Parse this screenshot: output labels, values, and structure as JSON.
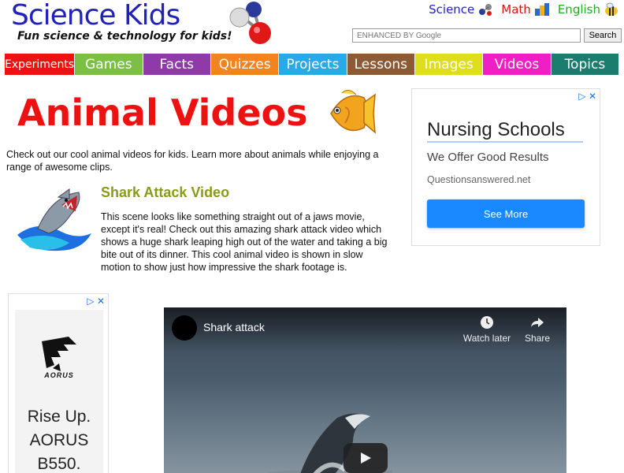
{
  "header": {
    "logo_title": "Science Kids",
    "logo_tagline": "Fun science & technology for kids!",
    "subjects": [
      {
        "label": "Science",
        "color": "#2222cc",
        "icon": "atom-icon"
      },
      {
        "label": "Math",
        "color": "#dd1111",
        "icon": "math-blocks-icon"
      },
      {
        "label": "English",
        "color": "#22aa22",
        "icon": "bee-icon"
      }
    ],
    "search_placeholder": "ENHANCED BY Google",
    "search_button": "Search"
  },
  "nav": [
    {
      "label": "Experiments",
      "color": "#ee1111"
    },
    {
      "label": "Games",
      "color": "#7bc043"
    },
    {
      "label": "Facts",
      "color": "#8e3aa8"
    },
    {
      "label": "Quizzes",
      "color": "#f2831f"
    },
    {
      "label": "Projects",
      "color": "#29a9e8"
    },
    {
      "label": "Lessons",
      "color": "#8c5b36"
    },
    {
      "label": "Images",
      "color": "#dede1a"
    },
    {
      "label": "Videos",
      "color": "#ee1fc4"
    },
    {
      "label": "Topics",
      "color": "#1a7d6e"
    }
  ],
  "main": {
    "title": "Animal Videos",
    "intro": "Check out our cool animal videos for kids. Learn more about animals while enjoying a range of awesome clips.",
    "article_title": "Shark Attack Video",
    "article_body": "This scene looks like something straight out of a jaws movie, except it's real! Check out this amazing shark attack video which shows a huge shark leaping high out of the water and taking a big bite out of its dinner. This cool animal video is shown in slow motion to show just how impressive the shark footage is."
  },
  "ad_right": {
    "headline": "Nursing Schools",
    "subline": "We Offer Good Results",
    "domain": "Questionsanswered.net",
    "button": "See More"
  },
  "ad_left": {
    "brand": "AORUS",
    "line1": "Rise Up.",
    "line2": "AORUS",
    "line3": "B550."
  },
  "video": {
    "title": "Shark attack",
    "watch_later": "Watch later",
    "share": "Share"
  }
}
